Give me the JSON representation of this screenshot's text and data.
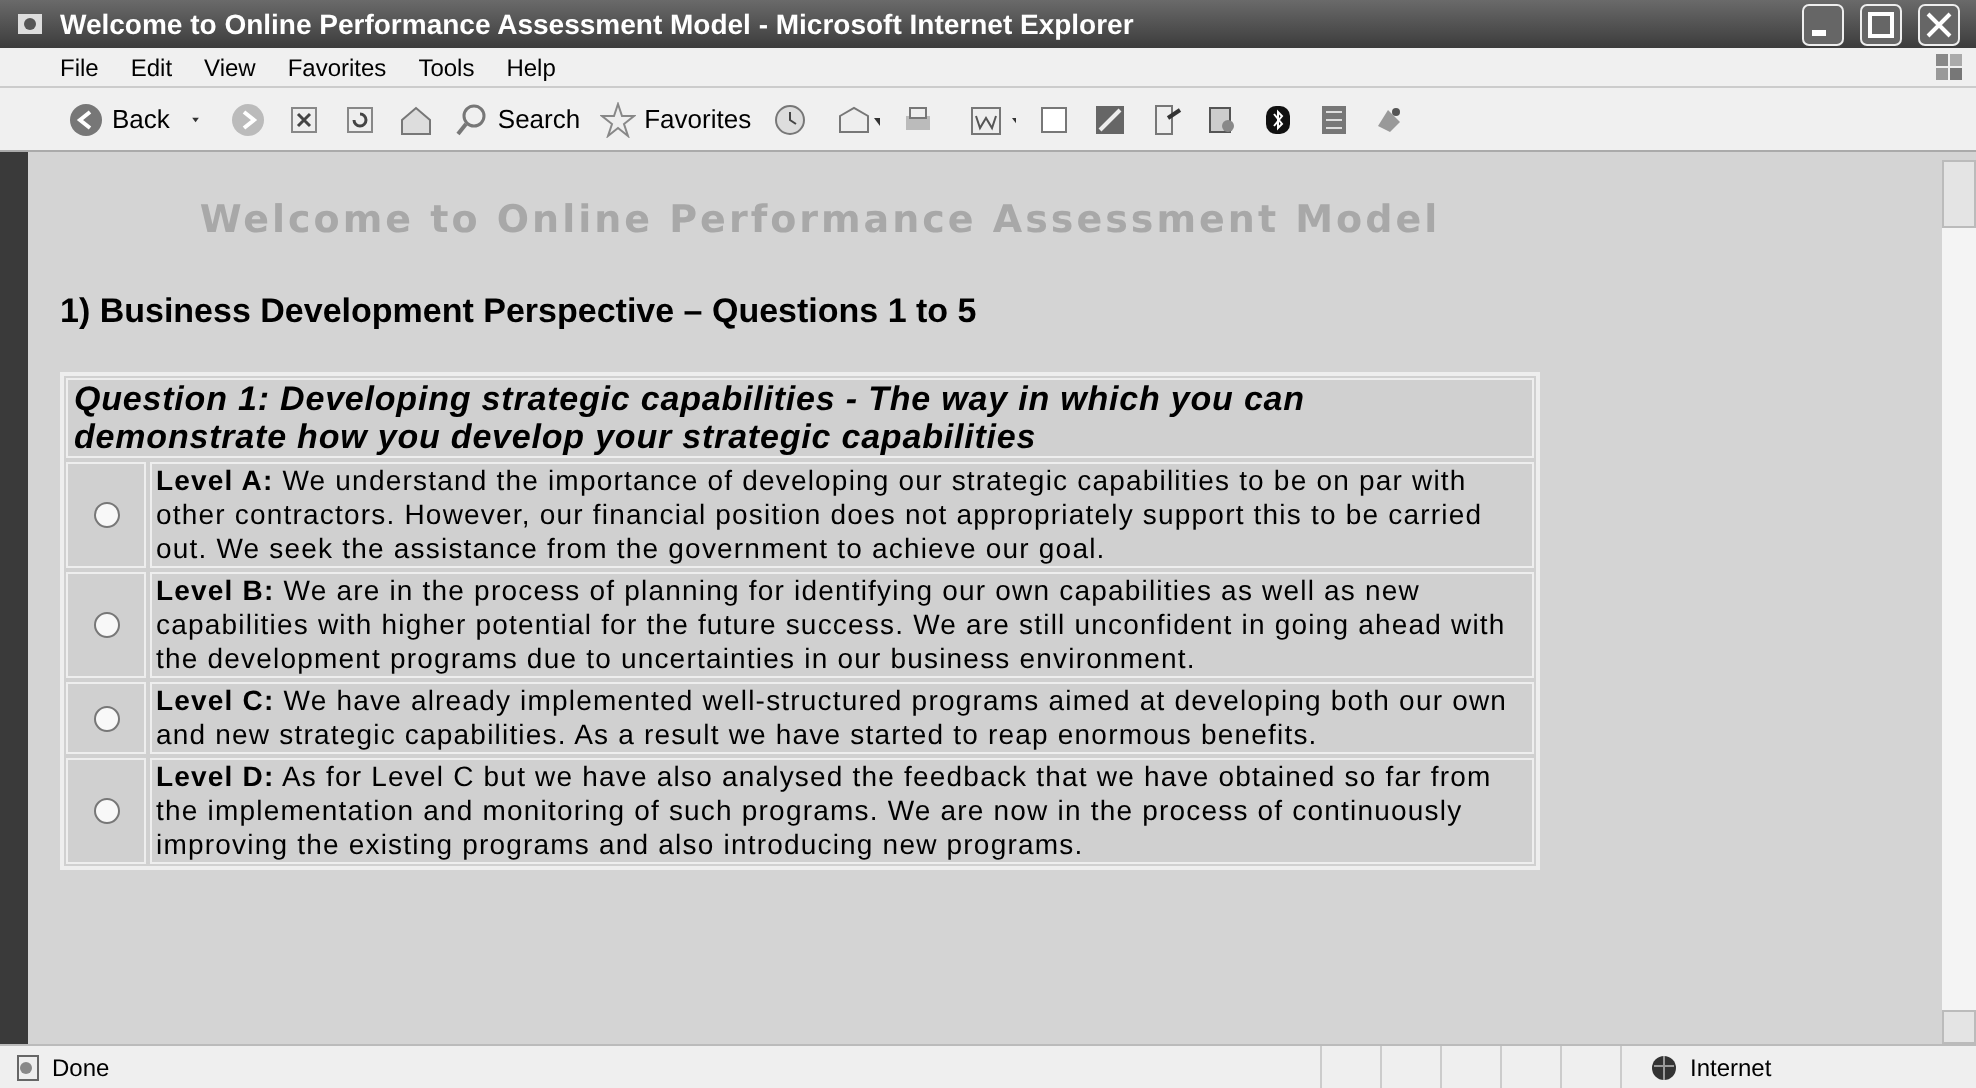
{
  "window": {
    "title": "Welcome to Online Performance Assessment Model - Microsoft Internet Explorer"
  },
  "menu": [
    "File",
    "Edit",
    "View",
    "Favorites",
    "Tools",
    "Help"
  ],
  "toolbar": {
    "back": "Back",
    "search": "Search",
    "favorites": "Favorites"
  },
  "page": {
    "banner": "Welcome to Online Performance Assessment Model",
    "section": "1) Business Development Perspective – Questions 1 to 5",
    "question": "Question 1: Developing strategic capabilities - The way in which you can demonstrate how you develop your strategic capabilities",
    "options": [
      {
        "text": "**Level A:** We understand the importance of developing our strategic capabilities to be on par with other contractors. However, our financial position does not appropriately support this to be carried out. We seek the assistance from the government to achieve our goal.",
        "selected": false
      },
      {
        "text": "**Level B:** We are in the process of planning for identifying our own capabilities as well as new capabilities with higher potential for the future success. We are still unconfident in going ahead with the development programs due to uncertainties in our business environment.",
        "selected": false
      },
      {
        "text": "**Level C:** We have already implemented well-structured programs aimed at developing both our own and new strategic capabilities. As a result we have started to reap enormous benefits.",
        "selected": false
      },
      {
        "text": "**Level D:** As for Level C but we have also analysed the feedback that we have obtained so far from the implementation and monitoring of such programs. We are now in the process of continuously improving the existing programs and also introducing new programs.",
        "selected": false
      }
    ]
  },
  "status_bar": {
    "text": "Done",
    "zone": "Internet"
  }
}
